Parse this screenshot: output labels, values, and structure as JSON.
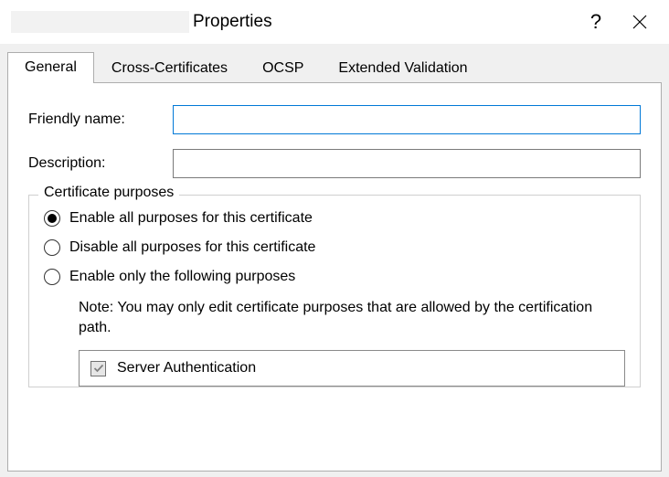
{
  "window": {
    "title": "Properties"
  },
  "tabs": {
    "general": "General",
    "cross": "Cross-Certificates",
    "ocsp": "OCSP",
    "ev": "Extended Validation"
  },
  "form": {
    "friendly_label": "Friendly name:",
    "friendly_value": "",
    "description_label": "Description:",
    "description_value": ""
  },
  "purposes": {
    "legend": "Certificate purposes",
    "enable_all": "Enable all purposes for this certificate",
    "disable_all": "Disable all purposes for this certificate",
    "enable_only": "Enable only the following purposes",
    "note": "Note: You may only edit certificate purposes that are allowed by the certification path.",
    "list": {
      "server_auth": "Server Authentication"
    }
  }
}
